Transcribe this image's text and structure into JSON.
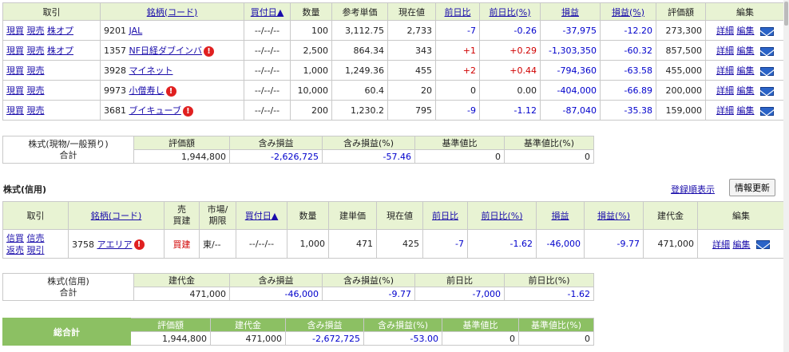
{
  "colors": {
    "header_bg": "#e8f3d3",
    "link": "#1a0dab",
    "negative": "#0000cc",
    "positive": "#d00000",
    "total_bar": "#8cc063"
  },
  "stock_table": {
    "headers": {
      "trade": "取引",
      "name": "銘柄(コード)",
      "buy_date": "買付日▲",
      "qty": "数量",
      "ref_price": "参考単価",
      "cur": "現在値",
      "prev_diff": "前日比",
      "prev_diff_pct": "前日比(%)",
      "pl": "損益",
      "pl_pct": "損益(%)",
      "value": "評価額",
      "edit": "編集"
    },
    "rows": [
      {
        "actions": [
          "現買",
          "現売",
          "株オプ"
        ],
        "code": "9201",
        "name": "JAL",
        "warn": false,
        "date": "--/--/--",
        "qty": "100",
        "ref": "3,112.75",
        "cur": "2,733",
        "diff": "-7",
        "diff_pct": "-0.26",
        "pl": "-37,975",
        "pl_pct": "-12.20",
        "value": "273,300"
      },
      {
        "actions": [
          "現買",
          "現売",
          "株オプ"
        ],
        "code": "1357",
        "name": "NF日経ダブインバ",
        "warn": true,
        "date": "--/--/--",
        "qty": "2,500",
        "ref": "864.34",
        "cur": "343",
        "diff": "+1",
        "diff_pct": "+0.29",
        "pl": "-1,303,350",
        "pl_pct": "-60.32",
        "value": "857,500"
      },
      {
        "actions": [
          "現買",
          "現売"
        ],
        "code": "3928",
        "name": "マイネット",
        "warn": false,
        "date": "--/--/--",
        "qty": "1,000",
        "ref": "1,249.36",
        "cur": "455",
        "diff": "+2",
        "diff_pct": "+0.44",
        "pl": "-794,360",
        "pl_pct": "-63.58",
        "value": "455,000"
      },
      {
        "actions": [
          "現買",
          "現売"
        ],
        "code": "9973",
        "name": "小僧寿し",
        "warn": true,
        "date": "--/--/--",
        "qty": "10,000",
        "ref": "60.4",
        "cur": "20",
        "diff": "0",
        "diff_pct": "0.00",
        "pl": "-404,000",
        "pl_pct": "-66.89",
        "value": "200,000"
      },
      {
        "actions": [
          "現買",
          "現売"
        ],
        "code": "3681",
        "name": "ブイキューブ",
        "warn": true,
        "date": "--/--/--",
        "qty": "200",
        "ref": "1,230.2",
        "cur": "795",
        "diff": "-9",
        "diff_pct": "-1.12",
        "pl": "-87,040",
        "pl_pct": "-35.38",
        "value": "159,000"
      }
    ],
    "detail_label": "詳細",
    "edit_label": "編集"
  },
  "stock_summary": {
    "label_top": "株式(現物/一般預り)",
    "label_bottom": "合計",
    "headers": [
      "評価額",
      "含み損益",
      "含み損益(%)",
      "基準値比",
      "基準値比(%)"
    ],
    "values": [
      "1,944,800",
      "-2,626,725",
      "-57.46",
      "0",
      "0"
    ]
  },
  "margin_section": {
    "title": "株式(信用)",
    "order_link": "登録順表示",
    "refresh_button": "情報更新"
  },
  "margin_table": {
    "headers": {
      "trade": "取引",
      "name": "銘柄(コード)",
      "side_top": "売",
      "side_bottom": "買建",
      "market_top": "市場/",
      "market_bottom": "期限",
      "buy_date": "買付日▲",
      "qty": "数量",
      "build_price": "建単価",
      "cur": "現在値",
      "prev_diff": "前日比",
      "prev_diff_pct": "前日比(%)",
      "pl": "損益",
      "pl_pct": "損益(%)",
      "build_amount": "建代金",
      "edit": "編集"
    },
    "row": {
      "actions": [
        "信買",
        "信売",
        "返売",
        "現引"
      ],
      "code": "3758",
      "name": "アエリア",
      "side": "買建",
      "market": "東/--",
      "date": "--/--/--",
      "qty": "1,000",
      "build": "471",
      "cur": "425",
      "diff": "-7",
      "diff_pct": "-1.62",
      "pl": "-46,000",
      "pl_pct": "-9.77",
      "amount": "471,000"
    }
  },
  "margin_summary": {
    "label_top": "株式(信用)",
    "label_bottom": "合計",
    "headers": [
      "建代金",
      "含み損益",
      "含み損益(%)",
      "前日比",
      "前日比(%)"
    ],
    "values": [
      "471,000",
      "-46,000",
      "-9.77",
      "-7,000",
      "-1.62"
    ]
  },
  "grand_total": {
    "label": "総合計",
    "headers": [
      "評価額",
      "建代金",
      "含み損益",
      "含み損益(%)",
      "基準値比",
      "基準値比(%)"
    ],
    "values": [
      "1,944,800",
      "471,000",
      "-2,672,725",
      "-53.00",
      "0",
      "0"
    ]
  }
}
